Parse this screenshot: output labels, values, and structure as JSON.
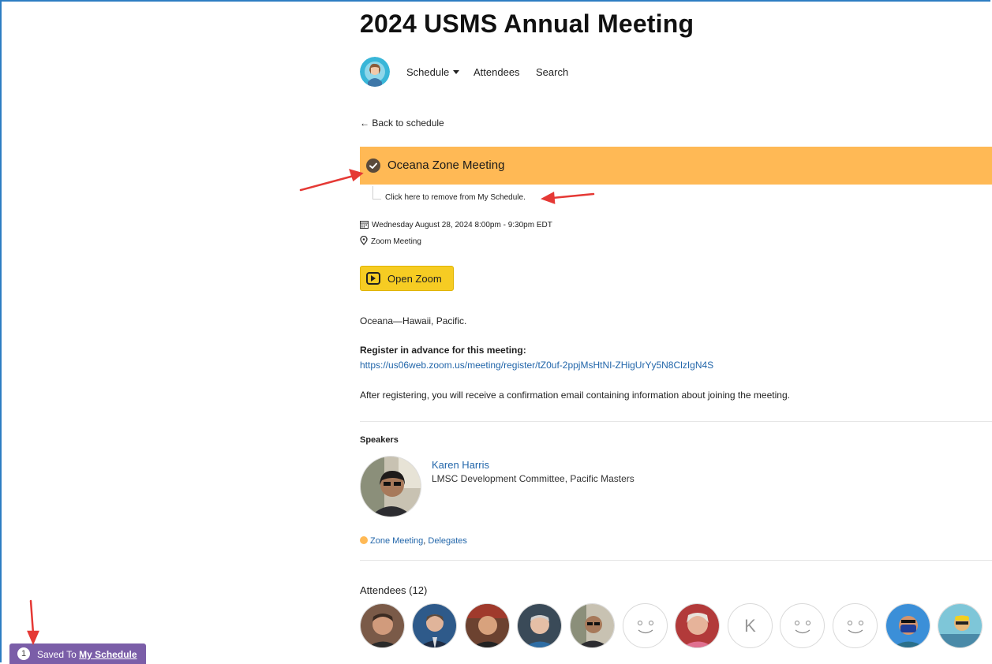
{
  "header": {
    "title": "2024 USMS Annual Meeting",
    "nav": {
      "schedule": "Schedule",
      "attendees": "Attendees",
      "search": "Search"
    }
  },
  "back_link": "← Back to schedule",
  "session": {
    "title": "Oceana Zone Meeting",
    "remove_hint": "Click here to remove from My Schedule.",
    "datetime": "Wednesday August 28, 2024 8:00pm - 9:30pm EDT",
    "location": "Zoom Meeting",
    "zoom_button": "Open Zoom",
    "description": "Oceana—Hawaii, Pacific.",
    "register_label": "Register in advance for this meeting:",
    "register_url": "https://us06web.zoom.us/meeting/register/tZ0uf-2ppjMsHtNI-ZHigUrYy5N8ClzIgN4S",
    "after_register": "After registering, you will receive a confirmation email containing information about joining the meeting.",
    "accent_color": "#ffb955"
  },
  "speakers": {
    "heading": "Speakers",
    "items": [
      {
        "name": "Karen Harris",
        "role": "LMSC Development Committee, Pacific Masters"
      }
    ]
  },
  "tags": [
    "Zone Meeting",
    "Delegates"
  ],
  "tag_separator": ",",
  "attendees": {
    "heading": "Attendees (12)",
    "items": [
      {
        "type": "photo"
      },
      {
        "type": "photo"
      },
      {
        "type": "photo"
      },
      {
        "type": "photo"
      },
      {
        "type": "photo"
      },
      {
        "type": "smiley"
      },
      {
        "type": "photo"
      },
      {
        "type": "initial",
        "initial": "K"
      },
      {
        "type": "smiley"
      },
      {
        "type": "smiley"
      },
      {
        "type": "photo"
      },
      {
        "type": "photo"
      }
    ]
  },
  "saved_bar": {
    "count": "1",
    "text": "Saved To",
    "link": "My Schedule",
    "color": "#7b5ea8"
  }
}
